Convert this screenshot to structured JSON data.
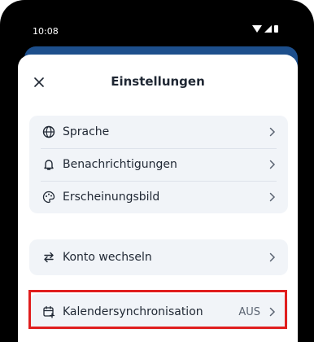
{
  "status_bar": {
    "time": "10:08"
  },
  "sheet": {
    "title": "Einstellungen",
    "close_icon": "close-icon"
  },
  "groups": [
    {
      "items": [
        {
          "label": "Sprache",
          "icon": "globe-icon"
        },
        {
          "label": "Benachrichtigungen",
          "icon": "bell-icon"
        },
        {
          "label": "Erscheinungsbild",
          "icon": "palette-icon"
        }
      ]
    },
    {
      "items": [
        {
          "label": "Konto wechseln",
          "icon": "switch-arrows-icon"
        }
      ]
    },
    {
      "items": [
        {
          "label": "Kalendersynchronisation",
          "icon": "calendar-add-icon",
          "value": "AUS"
        }
      ]
    }
  ],
  "colors": {
    "accent_blue": "#1d4f8c",
    "highlight_red": "#e01e1e",
    "row_background": "#f1f4f8"
  }
}
